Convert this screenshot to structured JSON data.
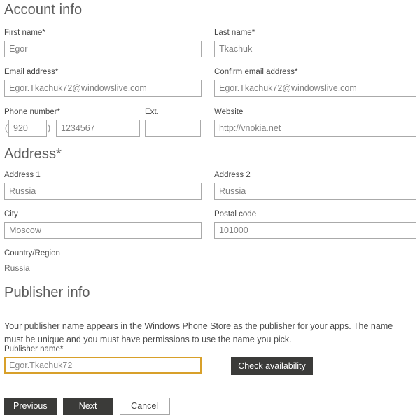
{
  "account": {
    "heading": "Account info",
    "first_name": {
      "label": "First name*",
      "value": "Egor"
    },
    "last_name": {
      "label": "Last name*",
      "value": "Tkachuk"
    },
    "email": {
      "label": "Email address*",
      "value": "Egor.Tkachuk72@windowslive.com"
    },
    "confirm_email": {
      "label": "Confirm email address*",
      "value": "Egor.Tkachuk72@windowslive.com"
    },
    "phone": {
      "label": "Phone number*",
      "open_paren": "(",
      "close_paren": ")",
      "area_code": "920",
      "number": "1234567"
    },
    "ext": {
      "label": "Ext.",
      "value": ""
    },
    "website": {
      "label": "Website",
      "value": "http://vnokia.net"
    }
  },
  "address": {
    "heading": "Address*",
    "address1": {
      "label": "Address 1",
      "value": "Russia"
    },
    "address2": {
      "label": "Address 2",
      "value": "Russia"
    },
    "city": {
      "label": "City",
      "value": "Moscow"
    },
    "postal_code": {
      "label": "Postal code",
      "value": "101000"
    },
    "country": {
      "label": "Country/Region",
      "value": "Russia"
    }
  },
  "publisher": {
    "heading": "Publisher info",
    "description": "Your publisher name appears in the Windows Phone Store as the publisher for your apps. The name must be unique and you must have permissions to use the name you pick.",
    "name": {
      "label": "Publisher name*",
      "value": "Egor.Tkachuk72"
    },
    "check_availability_label": "Check availability"
  },
  "footer": {
    "previous_label": "Previous",
    "next_label": "Next",
    "cancel_label": "Cancel"
  },
  "colors": {
    "accent_focus": "#d8a02a",
    "button_dark": "#3b3b39",
    "heading": "#5b5b5b",
    "input_border": "#aaaaaa",
    "input_text": "#808080"
  }
}
